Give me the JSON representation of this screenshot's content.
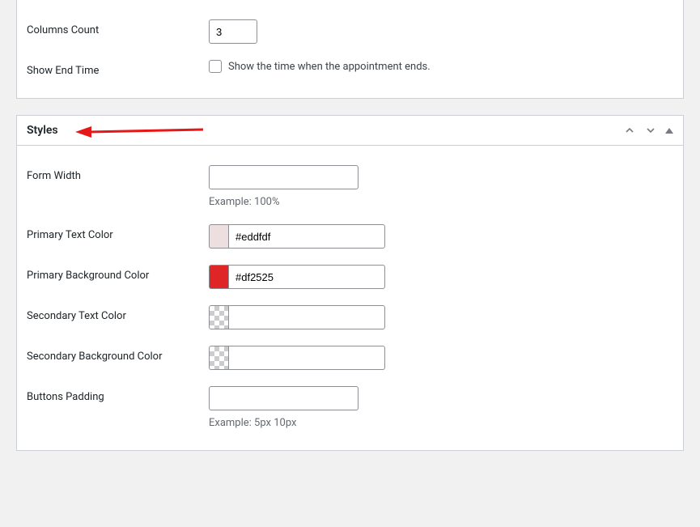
{
  "section_top": {
    "fields": {
      "columns_count": {
        "label": "Columns Count",
        "value": "3"
      },
      "show_end_time": {
        "label": "Show End Time",
        "checkbox_text": "Show the time when the appointment ends."
      }
    }
  },
  "section_styles": {
    "title": "Styles",
    "fields": {
      "form_width": {
        "label": "Form Width",
        "value": "",
        "hint": "Example: 100%"
      },
      "primary_text_color": {
        "label": "Primary Text Color",
        "value": "#eddfdf",
        "swatch": "#eddfdf"
      },
      "primary_bg_color": {
        "label": "Primary Background Color",
        "value": "#df2525",
        "swatch": "#df2525"
      },
      "secondary_text_color": {
        "label": "Secondary Text Color",
        "value": "",
        "swatch": "transparent"
      },
      "secondary_bg_color": {
        "label": "Secondary Background Color",
        "value": "",
        "swatch": "transparent"
      },
      "buttons_padding": {
        "label": "Buttons Padding",
        "value": "",
        "hint": "Example: 5px 10px"
      }
    }
  }
}
